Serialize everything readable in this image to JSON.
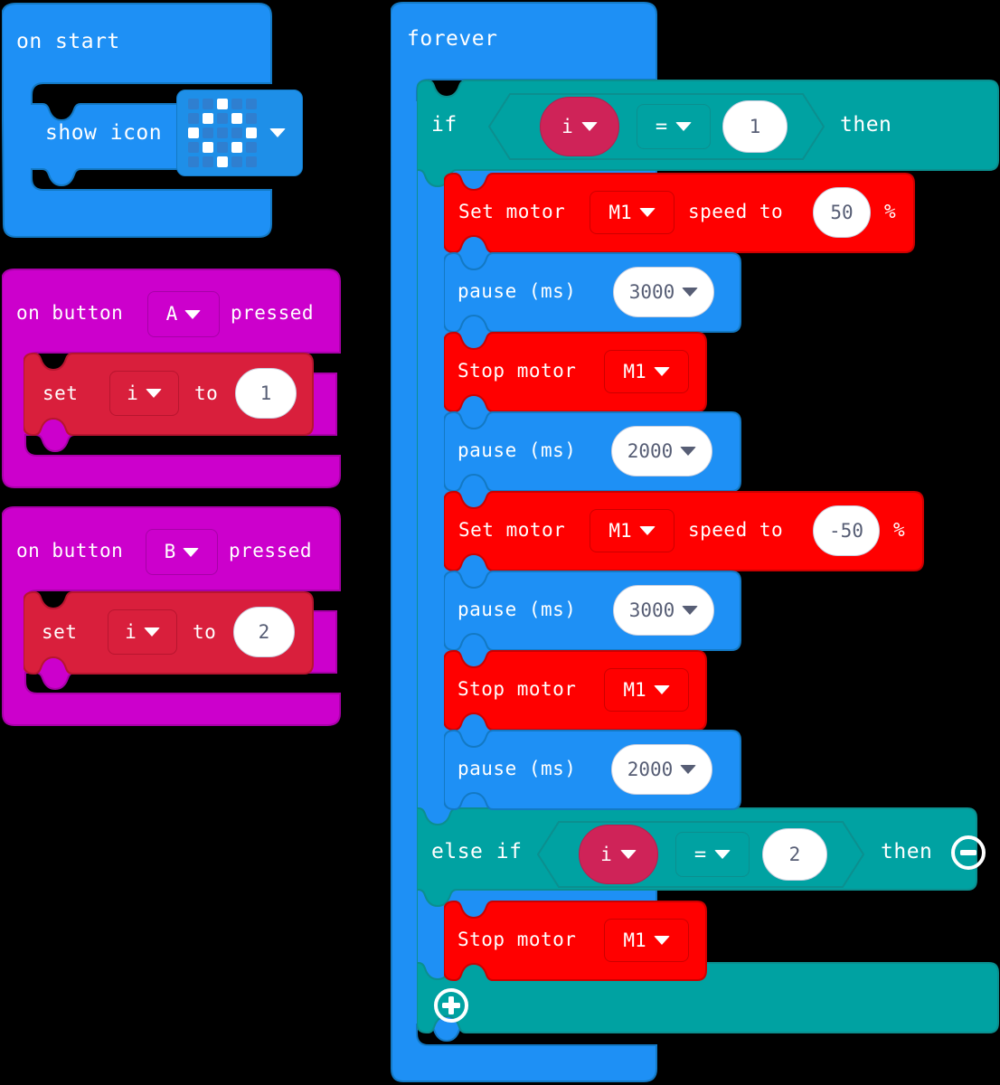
{
  "workspace": {
    "background": "#000000",
    "colors": {
      "event_blue": "#1E90F5",
      "loop_blue": "#1E90F5",
      "variable_red": "#D91F3C",
      "event_magenta": "#CC00CC",
      "logic_teal": "#00A2A2",
      "motor_red": "#FF0000",
      "basic_blue": "#1E90F5",
      "var_pill": "#CF2358",
      "field_text": "#575E75"
    }
  },
  "scripts": [
    {
      "id": "on-start",
      "type": "event-hat",
      "label": "on start",
      "children": [
        {
          "id": "show-icon",
          "type": "statement",
          "label": "show icon",
          "icon_field": {
            "name": "icon-matrix",
            "pattern": [
              [
                0,
                0,
                1,
                0,
                0
              ],
              [
                0,
                1,
                0,
                1,
                0
              ],
              [
                1,
                0,
                0,
                0,
                1
              ],
              [
                0,
                1,
                0,
                1,
                0
              ],
              [
                0,
                0,
                1,
                0,
                0
              ]
            ]
          }
        }
      ]
    },
    {
      "id": "on-button-a",
      "type": "event-hat",
      "label_before": "on button",
      "button": "A",
      "label_after": "pressed",
      "children": [
        {
          "id": "set-i-1",
          "type": "statement",
          "label_before": "set",
          "variable": "i",
          "label_mid": "to",
          "value": "1"
        }
      ]
    },
    {
      "id": "on-button-b",
      "type": "event-hat",
      "label_before": "on button",
      "button": "B",
      "label_after": "pressed",
      "children": [
        {
          "id": "set-i-2",
          "type": "statement",
          "label_before": "set",
          "variable": "i",
          "label_mid": "to",
          "value": "2"
        }
      ]
    },
    {
      "id": "forever",
      "type": "loop-hat",
      "label": "forever",
      "children": [
        {
          "id": "if-else-if",
          "type": "conditional",
          "if_label": "if",
          "else_if_label": "else if",
          "then_label": "then",
          "branches": [
            {
              "condition": {
                "variable": "i",
                "operator": "=",
                "value": "1"
              },
              "body": [
                {
                  "id": "set-motor-1",
                  "type": "motor-speed",
                  "label_before": "Set motor",
                  "motor": "M1",
                  "label_mid": "speed to",
                  "value": "50",
                  "unit": "%"
                },
                {
                  "id": "pause-1",
                  "type": "pause",
                  "label": "pause (ms)",
                  "value": "3000"
                },
                {
                  "id": "stop-motor-1",
                  "type": "motor-stop",
                  "label": "Stop motor",
                  "motor": "M1"
                },
                {
                  "id": "pause-2",
                  "type": "pause",
                  "label": "pause (ms)",
                  "value": "2000"
                },
                {
                  "id": "set-motor-2",
                  "type": "motor-speed",
                  "label_before": "Set motor",
                  "motor": "M1",
                  "label_mid": "speed to",
                  "value": "-50",
                  "unit": "%"
                },
                {
                  "id": "pause-3",
                  "type": "pause",
                  "label": "pause (ms)",
                  "value": "3000"
                },
                {
                  "id": "stop-motor-2",
                  "type": "motor-stop",
                  "label": "Stop motor",
                  "motor": "M1"
                },
                {
                  "id": "pause-4",
                  "type": "pause",
                  "label": "pause (ms)",
                  "value": "2000"
                }
              ]
            },
            {
              "condition": {
                "variable": "i",
                "operator": "=",
                "value": "2"
              },
              "body": [
                {
                  "id": "stop-motor-3",
                  "type": "motor-stop",
                  "label": "Stop motor",
                  "motor": "M1"
                }
              ]
            }
          ],
          "remove_branch_button": "minus-icon",
          "add_branch_button": "plus-icon"
        }
      ]
    }
  ],
  "text": {
    "on_start": "on start",
    "show_icon": "show icon",
    "forever": "forever",
    "on_button": "on button",
    "pressed": "pressed",
    "btn_a": "A",
    "btn_b": "B",
    "set": "set",
    "to": "to",
    "var_i": "i",
    "val_1": "1",
    "val_2": "2",
    "if": "if",
    "else_if": "else if",
    "then": "then",
    "eq": "=",
    "set_motor": "Set motor",
    "stop_motor": "Stop motor",
    "speed_to": "speed to",
    "percent": "%",
    "motor_m1": "M1",
    "pause_ms": "pause (ms)",
    "speed_50": "50",
    "speed_neg50": "-50",
    "ms_3000": "3000",
    "ms_2000": "2000"
  }
}
